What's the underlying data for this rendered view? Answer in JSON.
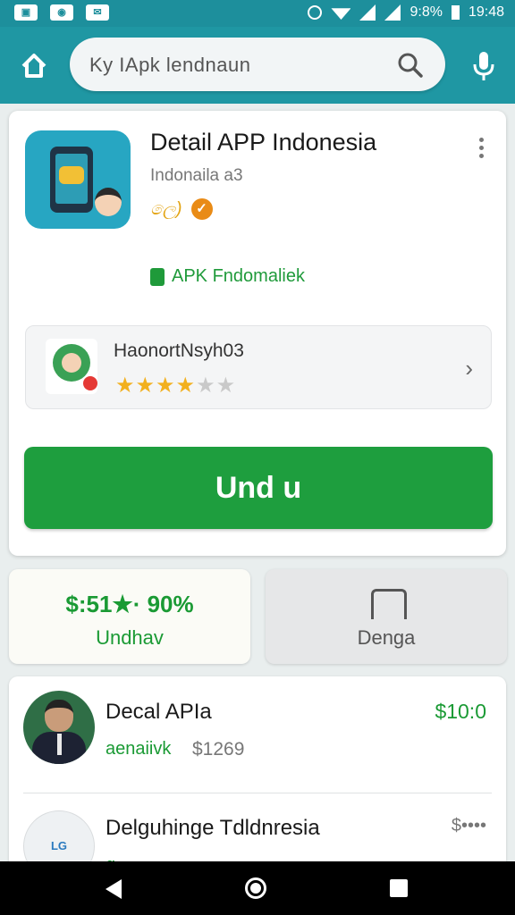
{
  "status_bar": {
    "battery": "9:8%",
    "time": "19:48",
    "left_icons": [
      "notification-icon",
      "message-icon",
      "mail-icon"
    ]
  },
  "header": {
    "search_query": "Ky IApk lendnaun"
  },
  "app": {
    "title": "Detail APP Indonesia",
    "developer": "Indonaila a3",
    "badge_text": "ලෙ)",
    "badge_circle": "✓",
    "tag": "APK Fndomaliek"
  },
  "developer_row": {
    "name": "HaonortNsyh03",
    "rating_on": "★★★★",
    "rating_off": "★★",
    "rating_value": 4
  },
  "install_button": {
    "label": "Und u"
  },
  "tiles": {
    "left_value": "$:51★· 90%",
    "left_label": "Undhav",
    "right_label": "Denga"
  },
  "list": {
    "items": [
      {
        "title": "Decal APIa",
        "sub": "aenaiivk",
        "sub_price": "$1269",
        "price": "$10:0"
      },
      {
        "title": "Delguhinge Tdldnresia",
        "price": "$••••",
        "sub": "ɑ•••",
        "icon_text": "LG"
      }
    ]
  },
  "colors": {
    "accent": "#1f97a3",
    "primary_button": "#1e9e3e",
    "star": "#f2b01e"
  }
}
